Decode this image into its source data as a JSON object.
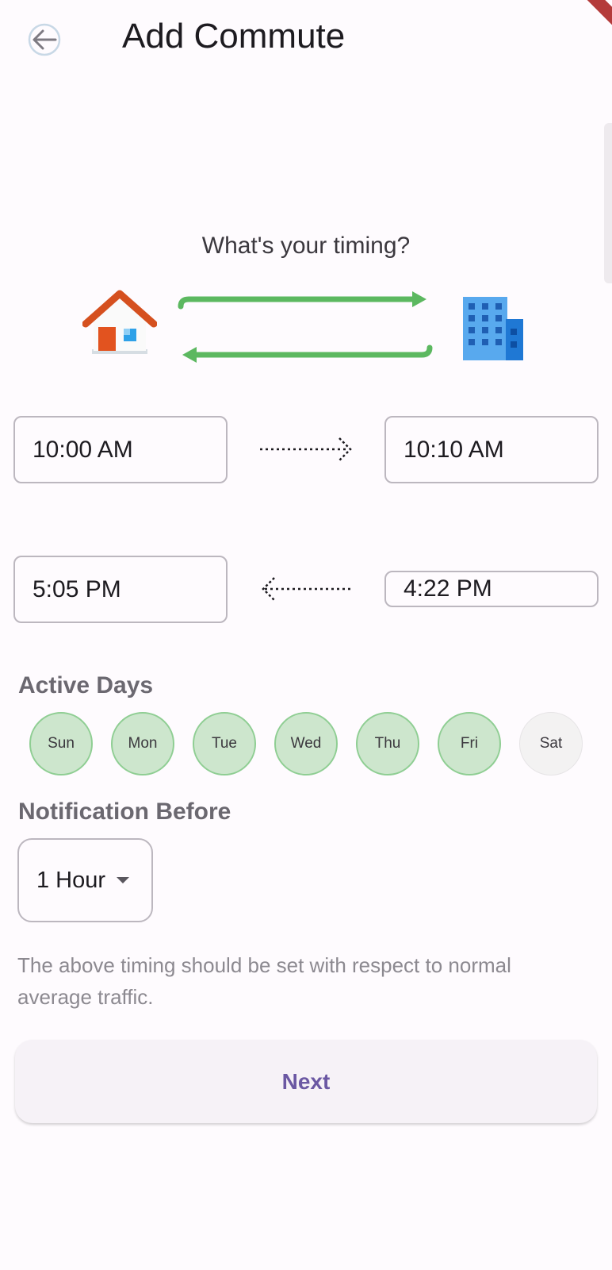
{
  "header": {
    "title": "Add Commute",
    "back_icon": "arrow-left-icon"
  },
  "timing": {
    "question": "What's your timing?",
    "home_icon": "house-icon",
    "office_icon": "office-building-icon",
    "route_colors": {
      "arrows": "#5cb860"
    },
    "morning": {
      "depart": "10:00 AM",
      "arrive": "10:10 AM"
    },
    "evening": {
      "arrive": "5:05 PM",
      "depart": "4:22 PM"
    }
  },
  "active_days": {
    "title": "Active Days",
    "days": [
      {
        "label": "Sun",
        "active": true
      },
      {
        "label": "Mon",
        "active": true
      },
      {
        "label": "Tue",
        "active": true
      },
      {
        "label": "Wed",
        "active": true
      },
      {
        "label": "Thu",
        "active": true
      },
      {
        "label": "Fri",
        "active": true
      },
      {
        "label": "Sat",
        "active": false
      }
    ]
  },
  "notification": {
    "title": "Notification Before",
    "selected": "1 Hour"
  },
  "hint": "The above timing should be set with respect to normal average traffic.",
  "next_label": "Next"
}
